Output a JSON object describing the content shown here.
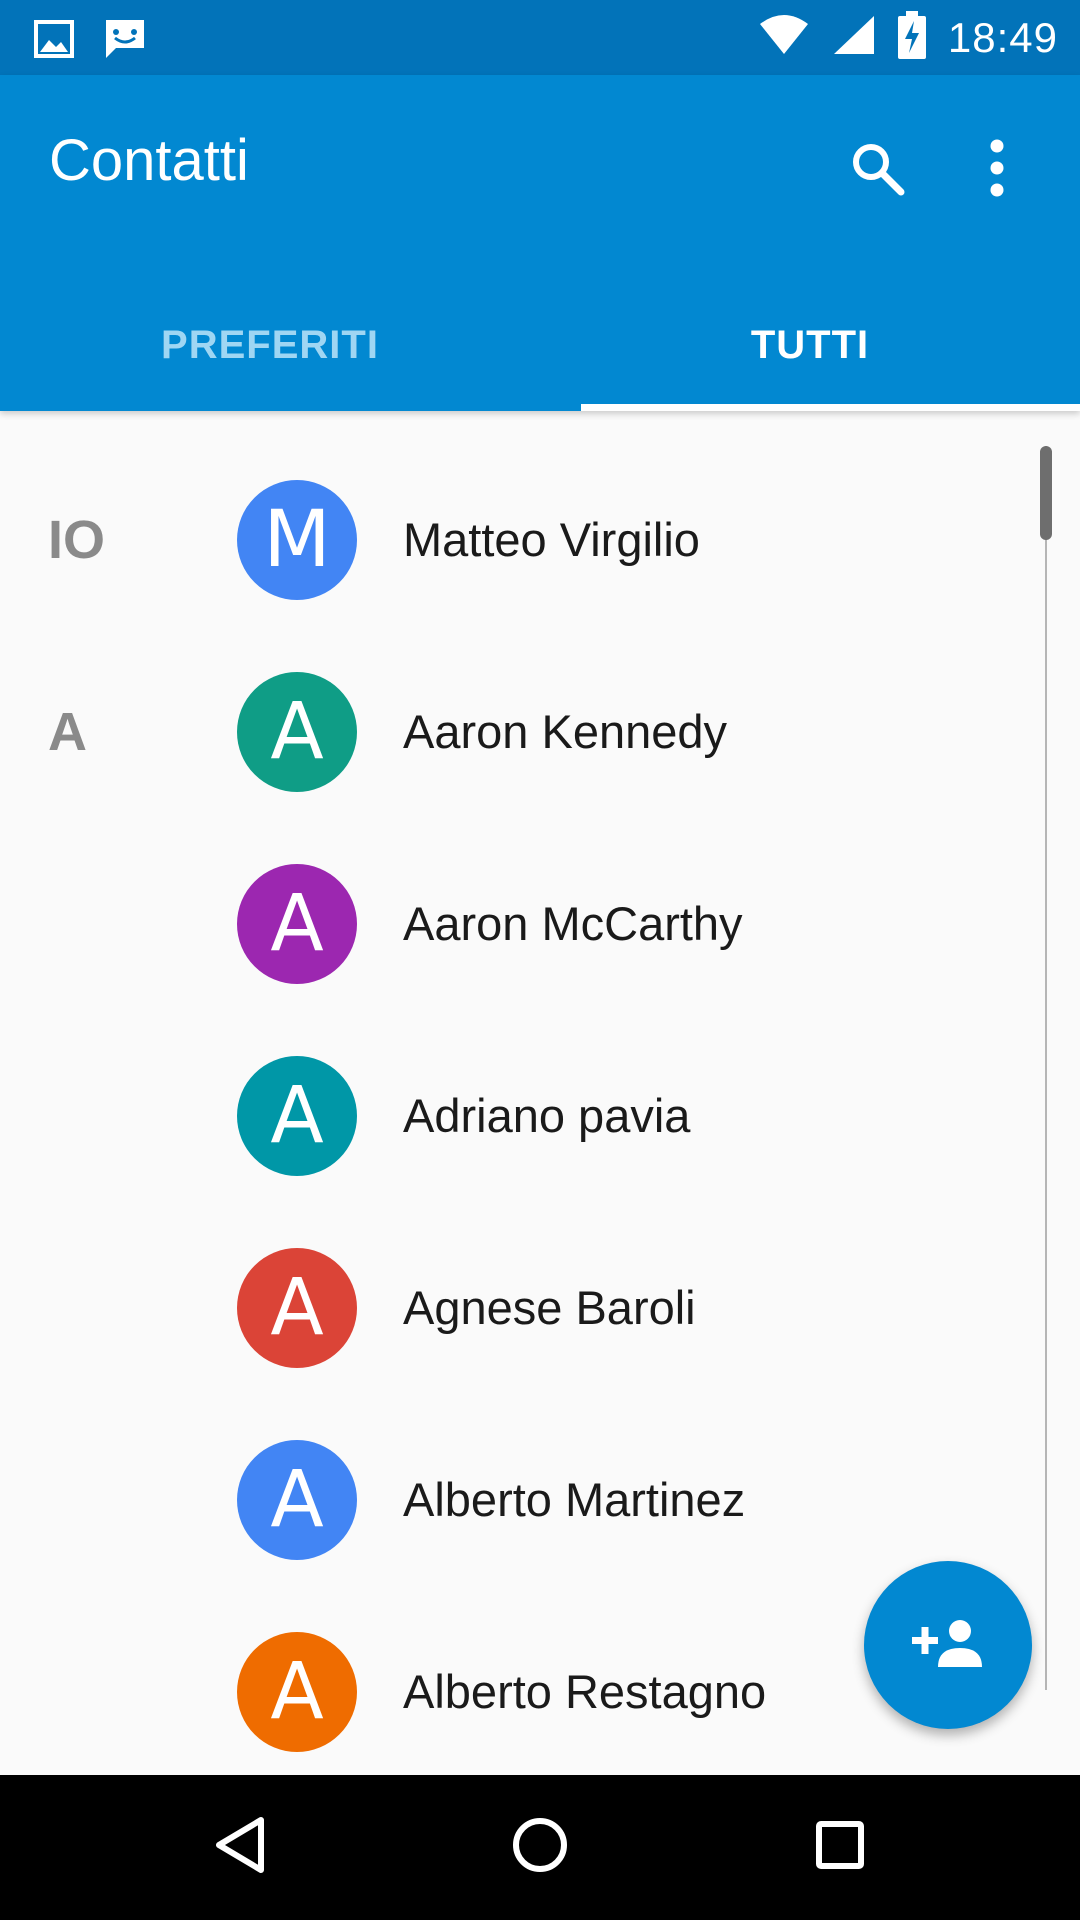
{
  "status_bar": {
    "time": "18:49",
    "left_icons": [
      "image-notification-icon",
      "message-notification-icon"
    ],
    "right_icons": [
      "wifi-icon",
      "cell-signal-icon",
      "battery-charging-icon"
    ]
  },
  "app_bar": {
    "title": "Contatti",
    "actions": [
      "search-icon",
      "more-vert-icon"
    ],
    "color": "#0288d1"
  },
  "tabs": [
    {
      "label": "PREFERITI",
      "active": false
    },
    {
      "label": "TUTTI",
      "active": true
    }
  ],
  "contacts": [
    {
      "section": "IO",
      "initial": "M",
      "name": "Matteo Virgilio",
      "color": "#4285f4"
    },
    {
      "section": "A",
      "initial": "A",
      "name": "Aaron Kennedy",
      "color": "#0f9d86"
    },
    {
      "section": "",
      "initial": "A",
      "name": "Aaron McCarthy",
      "color": "#9c27b0"
    },
    {
      "section": "",
      "initial": "A",
      "name": "Adriano pavia",
      "color": "#0097a7"
    },
    {
      "section": "",
      "initial": "A",
      "name": "Agnese Baroli",
      "color": "#db4437"
    },
    {
      "section": "",
      "initial": "A",
      "name": "Alberto Martinez",
      "color": "#4285f4"
    },
    {
      "section": "",
      "initial": "A",
      "name": "Alberto Restagno",
      "color": "#ef6c00"
    }
  ],
  "fab": {
    "icon": "add-contact-icon"
  },
  "nav_bar": {
    "buttons": [
      "back-icon",
      "home-icon",
      "recents-icon"
    ]
  }
}
